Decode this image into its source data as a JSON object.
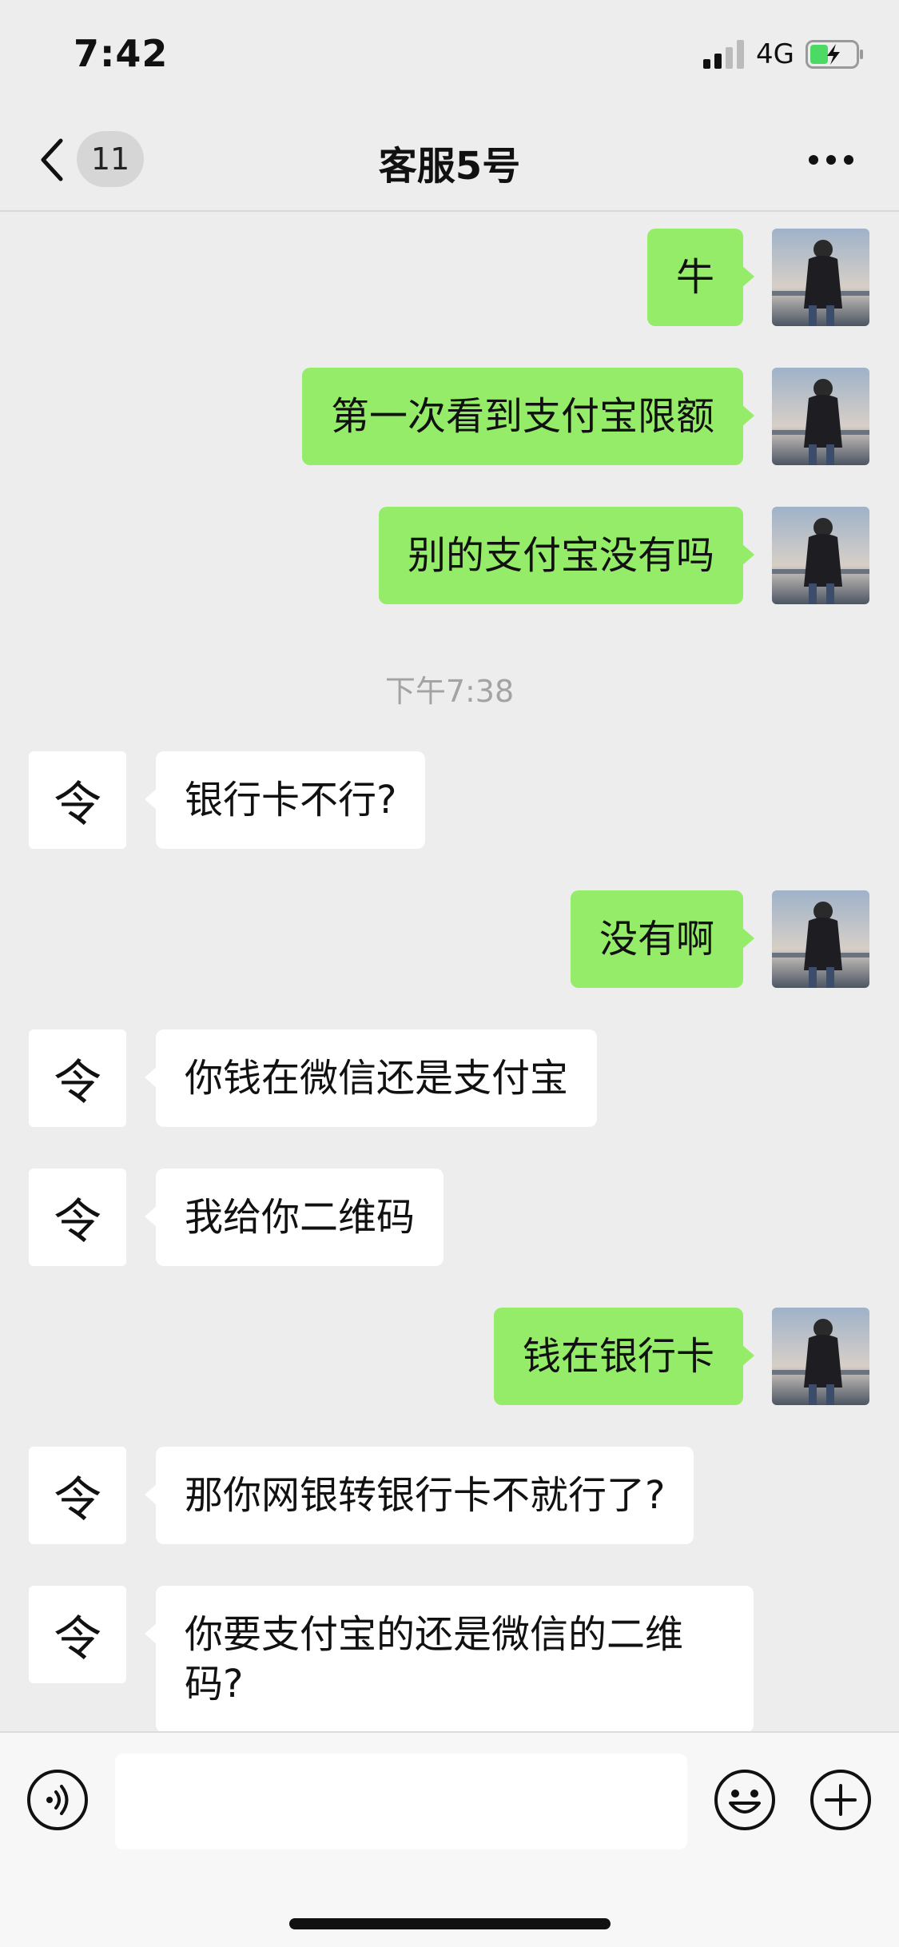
{
  "status_bar": {
    "time": "7:42",
    "network": "4G"
  },
  "nav": {
    "unread_count": "11",
    "title": "客服5号"
  },
  "messages": [
    {
      "text": "牛"
    },
    {
      "text": "第一次看到支付宝限额"
    },
    {
      "text": "别的支付宝没有吗"
    },
    {
      "text": "下午7:38"
    },
    {
      "text": "银行卡不行?"
    },
    {
      "text": "没有啊"
    },
    {
      "text": "你钱在微信还是支付宝"
    },
    {
      "text": "我给你二维码"
    },
    {
      "text": "钱在银行卡"
    },
    {
      "text": "那你网银转银行卡不就行了?"
    },
    {
      "text": "你要支付宝的还是微信的二维码?"
    }
  ],
  "input": {
    "placeholder": ""
  },
  "agent_avatar_glyph": "令",
  "colors": {
    "user_bubble": "#95ec69",
    "agent_bubble": "#ffffff",
    "background": "#ededed"
  }
}
